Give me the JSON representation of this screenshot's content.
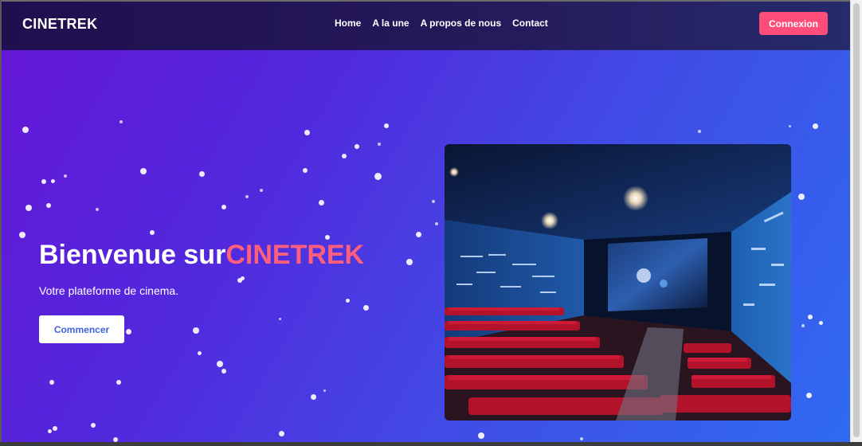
{
  "navbar": {
    "brand": "CINETREK",
    "links": [
      "Home",
      "A la une",
      "A propos de nous",
      "Contact"
    ],
    "login_label": "Connexion"
  },
  "hero": {
    "title_prefix": "Bienvenue sur",
    "title_accent": "CINETREK",
    "subtitle": "Votre plateforme de cinema.",
    "cta_label": "Commencer"
  },
  "colors": {
    "nav_bg": "#1f0f4f",
    "accent_pink": "#ff5f7c",
    "login_btn": "#ff4d79",
    "hero_gradient_start": "#6317d6",
    "hero_gradient_end": "#2f6af2"
  },
  "icons": {
    "hero_image": "cinema-theater-image"
  }
}
